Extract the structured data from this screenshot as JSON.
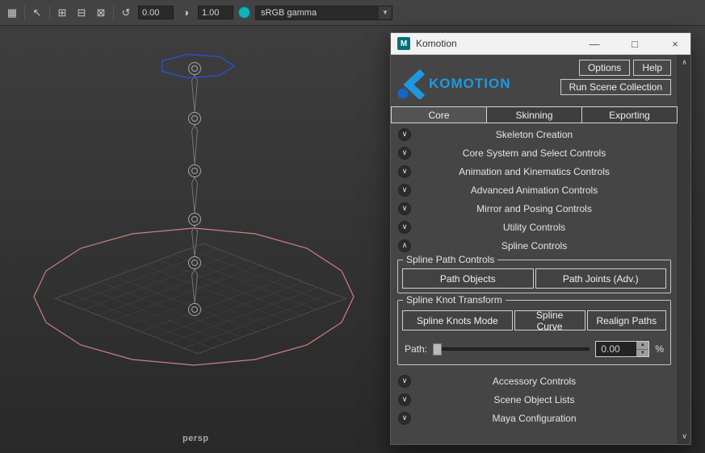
{
  "viewport_toolbar": {
    "exposure_value": "0.00",
    "gamma_value": "1.00",
    "colorspace": "sRGB gamma",
    "icons": {
      "grid": "▦",
      "cursor": "↖",
      "pane_split": "⊞",
      "pane_single": "⊟",
      "pane_close": "⊠",
      "exposure": "↺",
      "gamma": "◑",
      "caret": "▼"
    }
  },
  "viewport": {
    "camera_label": "persp"
  },
  "window": {
    "title": "Komotion",
    "app_icon_letter": "M",
    "controls": {
      "minimize": "—",
      "maximize": "□",
      "close": "×"
    },
    "brand": "KOMOTION",
    "header": {
      "options_btn": "Options",
      "help_btn": "Help",
      "run_btn": "Run Scene Collection"
    },
    "tabs": [
      {
        "label": "Core"
      },
      {
        "label": "Skinning"
      },
      {
        "label": "Exporting"
      }
    ],
    "sections": [
      {
        "label": "Skeleton Creation",
        "chevron": "∨"
      },
      {
        "label": "Core System and Select Controls",
        "chevron": "∨"
      },
      {
        "label": "Animation and Kinematics Controls",
        "chevron": "∨"
      },
      {
        "label": "Advanced Animation Controls",
        "chevron": "∨"
      },
      {
        "label": "Mirror and Posing Controls",
        "chevron": "∨"
      },
      {
        "label": "Utility Controls",
        "chevron": "∨"
      },
      {
        "label": "Spline Controls",
        "chevron": "∧"
      }
    ],
    "spline_path": {
      "legend": "Spline Path Controls",
      "path_objects_btn": "Path Objects",
      "path_joints_btn": "Path Joints (Adv.)"
    },
    "knot": {
      "legend": "Spline Knot Transform",
      "knots_mode_btn": "Spline Knots Mode",
      "curve_btn": "Spline Curve",
      "realign_btn": "Realign Paths",
      "path_label": "Path:",
      "path_value": "0.00",
      "spinner_up": "▲",
      "spinner_down": "▼",
      "unit": "%"
    },
    "bottom_sections": [
      {
        "label": "Accessory Controls",
        "chevron": "∨"
      },
      {
        "label": "Scene Object Lists",
        "chevron": "∨"
      },
      {
        "label": "Maya Configuration",
        "chevron": "∨"
      }
    ],
    "scrollbar": {
      "up": "∧",
      "down": "∨"
    },
    "colors": {
      "brand_blue": "#1d9ae3",
      "titlebar_teal": "#00717b"
    }
  }
}
